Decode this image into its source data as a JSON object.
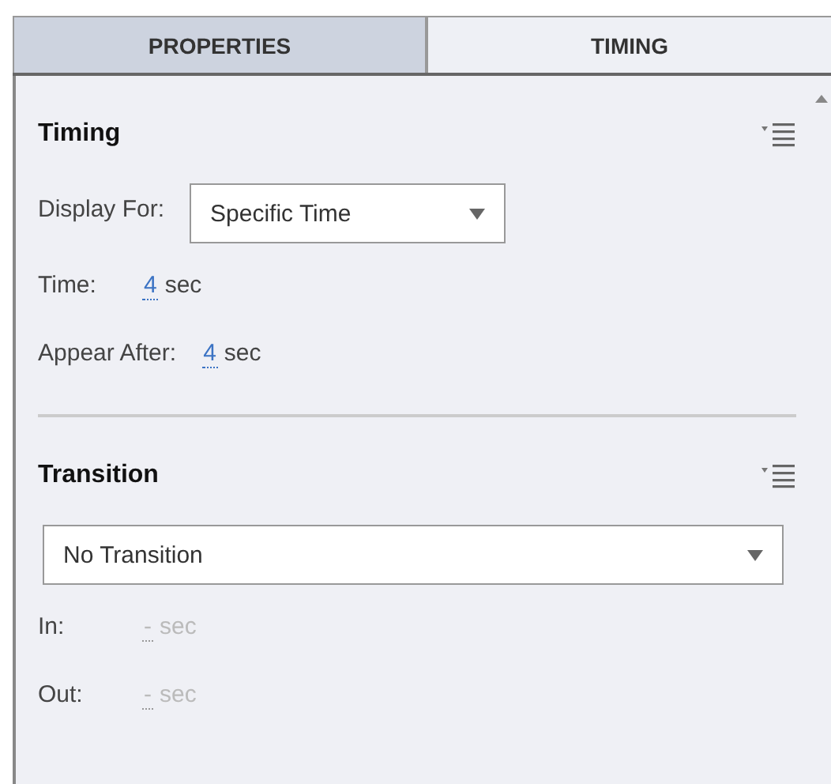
{
  "tabs": [
    {
      "label": "PROPERTIES",
      "selected": true
    },
    {
      "label": "TIMING",
      "selected": false
    }
  ],
  "sections": [
    {
      "title": "Timing",
      "rows": [
        {
          "kind": "dropdown",
          "label": "Display For:",
          "value": "Specific Time"
        },
        {
          "kind": "number",
          "label": "Time:",
          "value": "4",
          "unit": "sec",
          "disabled": false
        },
        {
          "kind": "number",
          "label": "Appear After:",
          "value": "4",
          "unit": "sec",
          "disabled": false
        }
      ]
    },
    {
      "title": "Transition",
      "rows": [
        {
          "kind": "wide-dropdown",
          "value": "No Transition"
        },
        {
          "kind": "number",
          "label": "In:",
          "value": "-",
          "unit": "sec",
          "disabled": true
        },
        {
          "kind": "number",
          "label": "Out:",
          "value": "-",
          "unit": "sec",
          "disabled": true
        }
      ]
    }
  ]
}
